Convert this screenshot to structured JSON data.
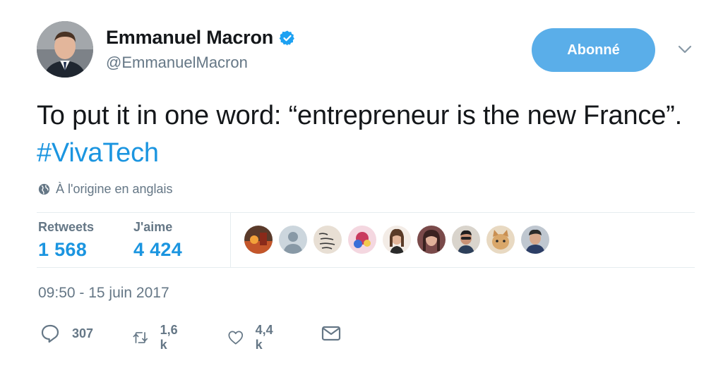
{
  "author": {
    "name": "Emmanuel Macron",
    "handle": "@EmmanuelMacron",
    "verified": true
  },
  "follow_button": {
    "label": "Abonné"
  },
  "tweet": {
    "text_before_hashtag": "To put it in one word: “entrepreneur is the new France”.",
    "hashtag": "#VivaTech"
  },
  "translate_note": "À l'origine en anglais",
  "stats": {
    "retweets_label": "Retweets",
    "retweets_value": "1 568",
    "likes_label": "J'aime",
    "likes_value": "4 424"
  },
  "likers_count_shown": 9,
  "timestamp": "09:50 - 15 juin 2017",
  "actions": {
    "reply_count": "307",
    "retweet_count": "1,6 k",
    "like_count": "4,4 k"
  },
  "colors": {
    "accent": "#1b95e0",
    "follow_button": "#5aaee9",
    "muted": "#657786",
    "divider": "#e6ecf0"
  },
  "icons": [
    "verified-badge-icon",
    "chevron-down-icon",
    "globe-icon",
    "reply-icon",
    "retweet-icon",
    "heart-icon",
    "direct-message-icon"
  ]
}
